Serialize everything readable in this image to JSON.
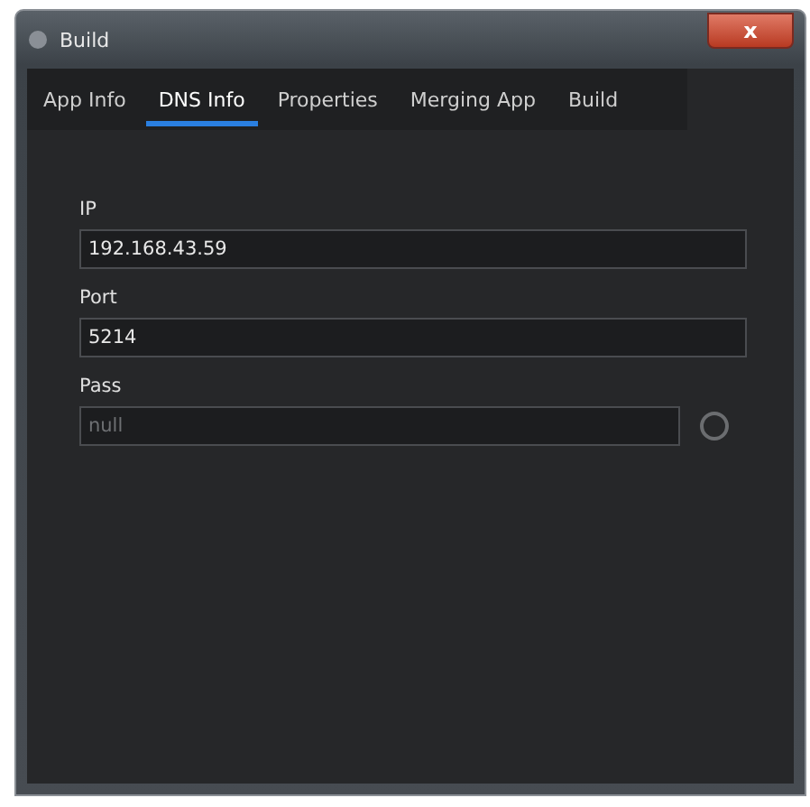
{
  "window": {
    "title": "Build",
    "close_symbol": "x"
  },
  "tabs": [
    {
      "label": "App Info",
      "selected": false
    },
    {
      "label": "DNS Info",
      "selected": true
    },
    {
      "label": "Properties",
      "selected": false
    },
    {
      "label": "Merging App",
      "selected": false
    },
    {
      "label": "Build",
      "selected": false
    }
  ],
  "fields": [
    {
      "label": "IP",
      "value": "192.168.43.59",
      "kind": "text"
    },
    {
      "label": "Port",
      "value": "5214",
      "kind": "text"
    },
    {
      "label": "Pass",
      "placeholder": "null",
      "kind": "password"
    }
  ]
}
